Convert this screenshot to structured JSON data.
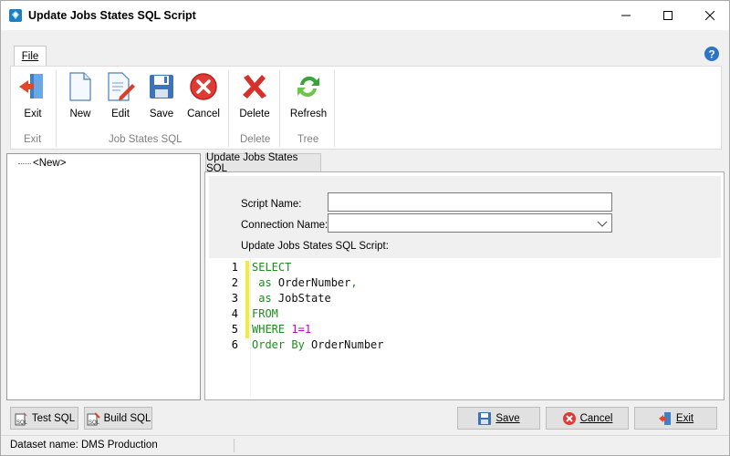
{
  "window": {
    "title": "Update Jobs States SQL Script"
  },
  "ribbon": {
    "file_tab": "File",
    "buttons": {
      "exit": "Exit",
      "new": "New",
      "edit": "Edit",
      "save": "Save",
      "cancel": "Cancel",
      "delete": "Delete",
      "refresh": "Refresh"
    },
    "groups": {
      "exit": "Exit",
      "job_states_sql": "Job States SQL",
      "delete": "Delete",
      "tree": "Tree"
    }
  },
  "tree": {
    "items": [
      {
        "label": "<New>"
      }
    ]
  },
  "content": {
    "tab_label": "Update Jobs States SQL",
    "form": {
      "script_name_label": "Script Name:",
      "script_name_value": "",
      "connection_name_label": "Connection Name:",
      "connection_name_value": "",
      "script_label": "Update Jobs States SQL Script:"
    },
    "editor": {
      "lines": [
        {
          "n": "1",
          "text": "SELECT"
        },
        {
          "n": "2",
          "text": " as OrderNumber,"
        },
        {
          "n": "3",
          "text": " as JobState"
        },
        {
          "n": "4",
          "text": "FROM"
        },
        {
          "n": "5",
          "text": "WHERE 1=1"
        },
        {
          "n": "6",
          "text": "Order By OrderNumber"
        }
      ]
    }
  },
  "bottom": {
    "test_sql": "Test SQL",
    "build_sql": "Build SQL",
    "save": "Save",
    "cancel": "Cancel",
    "exit": "Exit"
  },
  "status": {
    "dataset": "Dataset name:  DMS Production"
  },
  "colors": {
    "accent": "#2b74c7",
    "keyword": "#1e8c1e",
    "number": "#c400c4",
    "changed_marker": "#f3ec3b"
  }
}
